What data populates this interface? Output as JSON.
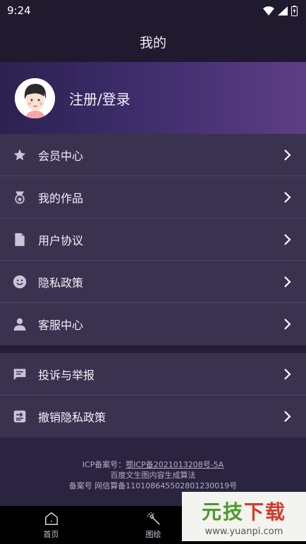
{
  "status_bar": {
    "time": "9:24"
  },
  "header": {
    "title": "我的"
  },
  "profile": {
    "login_label": "注册/登录"
  },
  "menu": [
    {
      "label": "会员中心",
      "icon": "star-icon"
    },
    {
      "label": "我的作品",
      "icon": "medal-icon"
    },
    {
      "label": "用户协议",
      "icon": "document-icon"
    },
    {
      "label": "隐私政策",
      "icon": "smiley-icon"
    },
    {
      "label": "客服中心",
      "icon": "person-icon"
    }
  ],
  "menu2": [
    {
      "label": "投诉与举报",
      "icon": "message-icon"
    },
    {
      "label": "撤销隐私政策",
      "icon": "revoke-icon"
    }
  ],
  "footer": {
    "icp_prefix": "ICP备案号：",
    "icp_link": "鄂ICP备2021013208号-5A",
    "line2": "百度文生图内容生成算法",
    "line3": "备案号 网信算备110108645502801230019号"
  },
  "bottom_nav": [
    {
      "label": "首页",
      "icon": "home-icon"
    },
    {
      "label": "图绘",
      "icon": "magic-wand-icon"
    }
  ],
  "watermark": {
    "title_green": "元技",
    "title_red": "下载",
    "url": "www.yuanpi.com"
  },
  "colors": {
    "background": "#2b2440",
    "menu_bg": "#3a3350",
    "accent_purple": "#5e3e84"
  }
}
